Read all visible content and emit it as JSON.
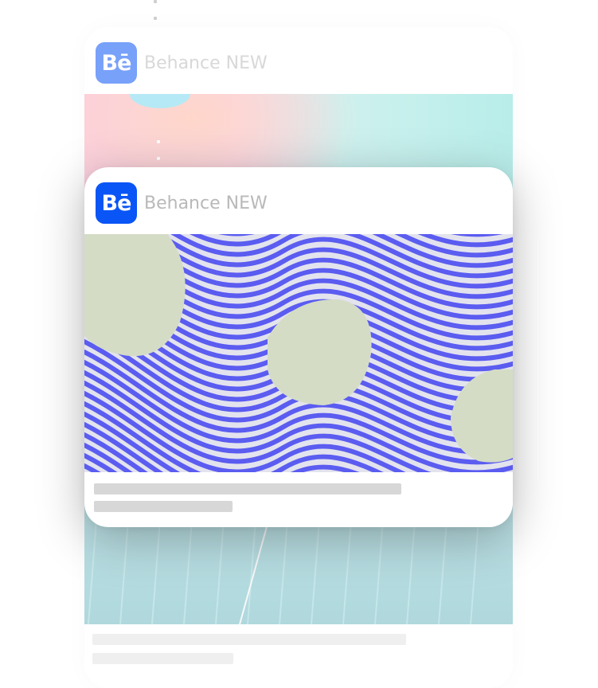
{
  "back_card": {
    "app_name": "Behance NEW",
    "logo_text": "Bē"
  },
  "front_card": {
    "app_name": "Behance NEW",
    "logo_text": "Bē"
  },
  "colors": {
    "behance_blue": "#0a55f5",
    "stripe_blue": "#5b5cf0",
    "blob_green": "#d4dcc6",
    "skeleton_gray": "#d7d7d7"
  },
  "icons": {
    "logo": "behance-logo-icon",
    "dots": "vertical-dots-icon"
  }
}
